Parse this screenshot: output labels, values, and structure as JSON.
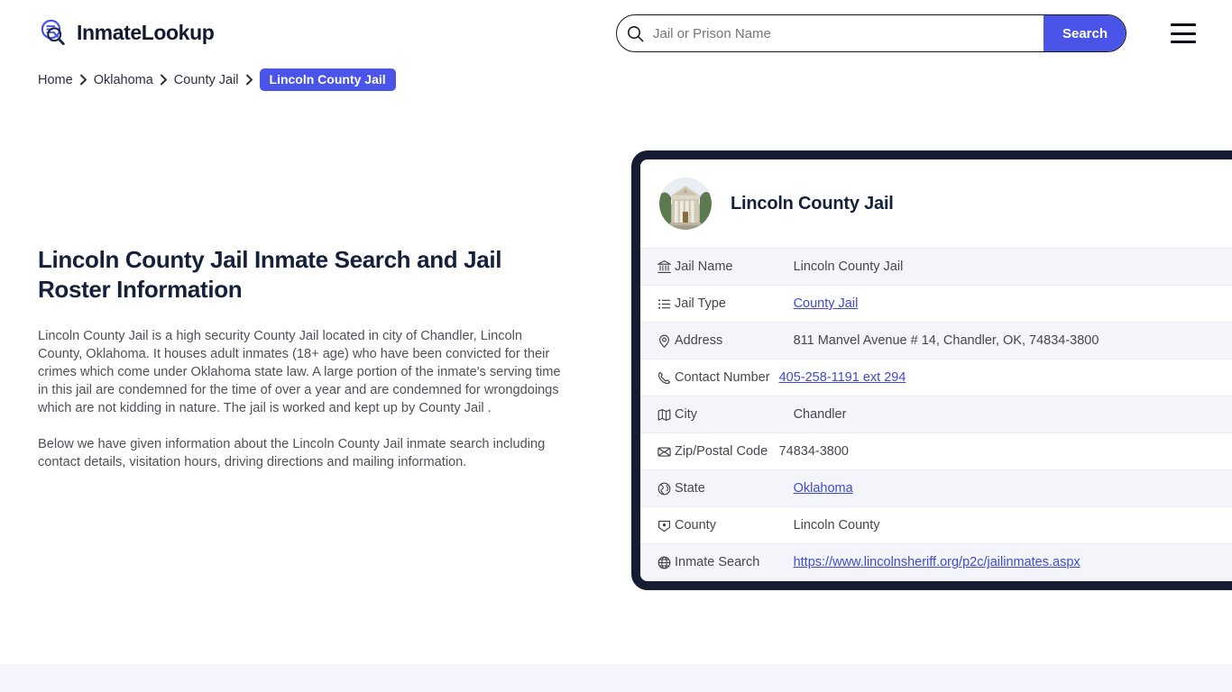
{
  "header": {
    "brand_name": "InmateLookup",
    "logo_icon": "magnifier-list-icon",
    "menu_icon": "hamburger-menu-icon",
    "accent_color": "#4a54e8",
    "dark_color": "#161d33"
  },
  "search": {
    "icon": "search-icon",
    "placeholder": "Jail or Prison Name",
    "value": "",
    "button_label": "Search"
  },
  "breadcrumb": {
    "items": [
      {
        "label": "Home",
        "current": false
      },
      {
        "label": "Oklahoma",
        "current": false
      },
      {
        "label": "County Jail",
        "current": false
      },
      {
        "label": "Lincoln County Jail",
        "current": true
      }
    ],
    "separator_icon": "chevron-right-icon"
  },
  "main": {
    "title": "Lincoln County Jail Inmate Search and Jail Roster Information",
    "paragraph_1": "Lincoln County Jail is a high security County Jail located in city of Chandler, Lincoln County, Oklahoma. It houses adult inmates (18+ age) who have been convicted for their crimes which come under Oklahoma state law. A large portion of the inmate's serving time in this jail are condemned for the time of over a year and are condemned for wrongdoings which are not kidding in nature. The jail is worked and kept up by County Jail .",
    "paragraph_2": "Below we have given information about the Lincoln County Jail inmate search including contact details, visitation hours, driving directions and mailing information."
  },
  "info_card": {
    "avatar_icon": "courthouse-photo",
    "title": "Lincoln County Jail",
    "rows": [
      {
        "icon": "bank-building-icon",
        "label": "Jail Name",
        "value": "Lincoln County Jail",
        "link": false
      },
      {
        "icon": "list-icon",
        "label": "Jail Type",
        "value": "County Jail",
        "link": true
      },
      {
        "icon": "map-pin-icon",
        "label": "Address",
        "value": "811 Manvel Avenue # 14, Chandler, OK, 74834-3800",
        "link": false
      },
      {
        "icon": "phone-icon",
        "label": "Contact Number",
        "value": "405-258-1191 ext 294",
        "link": true,
        "tight": true
      },
      {
        "icon": "map-icon",
        "label": "City",
        "value": "Chandler",
        "link": false
      },
      {
        "icon": "envelope-icon",
        "label": "Zip/Postal Code",
        "value": "74834-3800",
        "link": false,
        "tight": true
      },
      {
        "icon": "globe-americas-icon",
        "label": "State",
        "value": "Oklahoma",
        "link": true
      },
      {
        "icon": "county-marker-icon",
        "label": "County",
        "value": "Lincoln County",
        "link": false
      },
      {
        "icon": "globe-icon",
        "label": "Inmate Search",
        "value": "https://www.lincolnsheriff.org/p2c/jailinmates.aspx",
        "link": true
      }
    ]
  }
}
